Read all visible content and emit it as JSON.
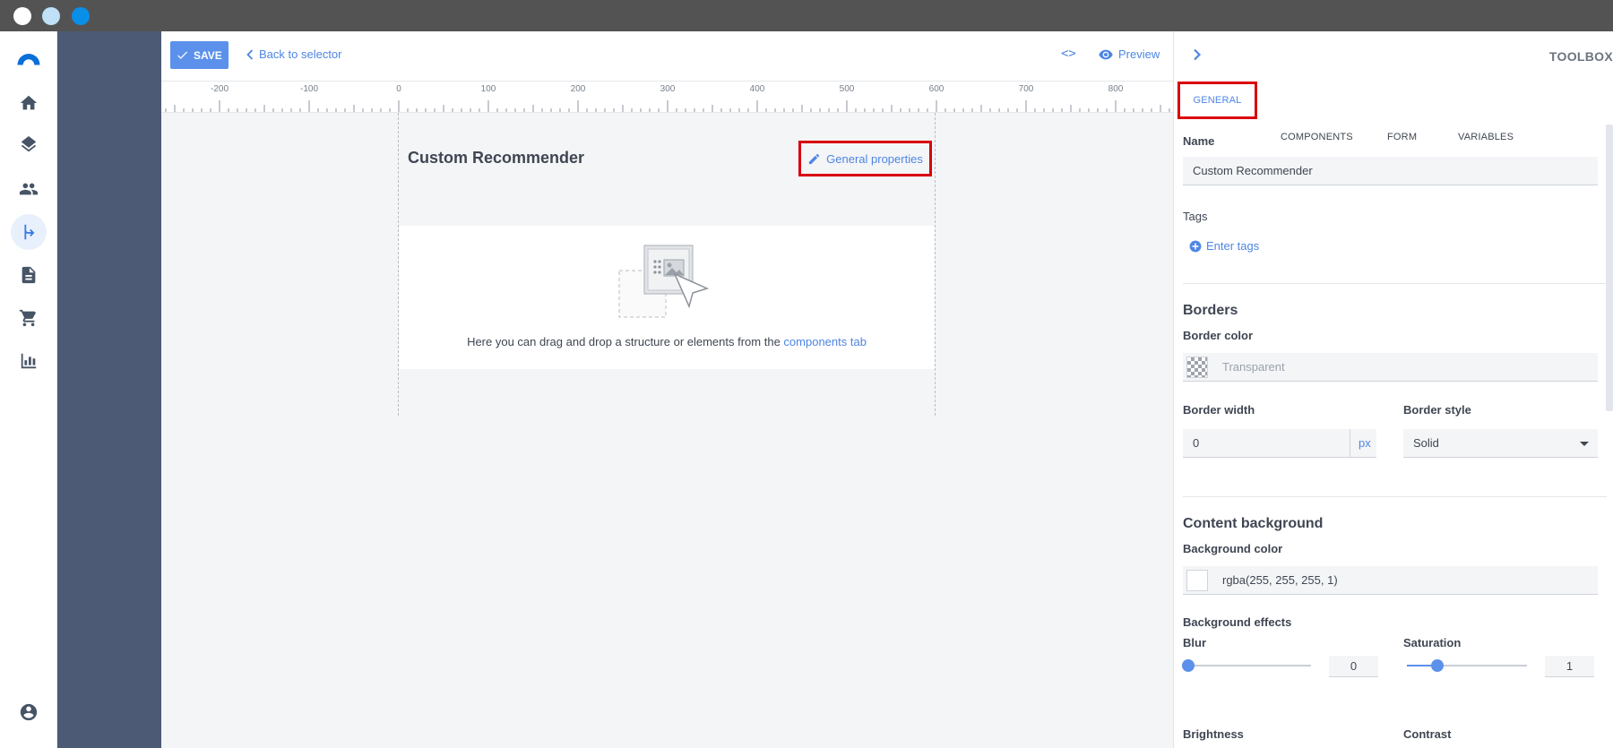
{
  "window": {
    "dots": [
      "#ffffff",
      "#bfe0f7",
      "#0a8fe8"
    ]
  },
  "rail": {
    "items": [
      "logo-icon",
      "home-icon",
      "layers-icon",
      "people-icon",
      "flow-icon",
      "document-icon",
      "cart-icon",
      "chart-icon",
      "account-icon"
    ],
    "active": "flow-icon"
  },
  "toolbar": {
    "save_label": "SAVE",
    "back_label": "Back to selector",
    "code_label": "<>",
    "preview_label": "Preview"
  },
  "ruler": {
    "labels": [
      "-200",
      "-100",
      "0",
      "100",
      "200",
      "300",
      "400",
      "500",
      "600",
      "700",
      "800"
    ]
  },
  "canvas": {
    "title": "Custom Recommender",
    "general_properties_label": "General properties",
    "dropzone_text": "Here you can drag and drop a structure or elements from the ",
    "dropzone_link": "components tab"
  },
  "toolbox": {
    "title": "TOOLBOX",
    "tabs": [
      "GENERAL",
      "COMPONENTS",
      "FORM",
      "VARIABLES"
    ],
    "active_tab": "GENERAL",
    "name_label": "Name",
    "name_value": "Custom Recommender",
    "tags_label": "Tags",
    "tags_placeholder": "Enter tags",
    "borders_heading": "Borders",
    "border_color_label": "Border color",
    "border_color_value": "Transparent",
    "border_width_label": "Border width",
    "border_width_value": "0",
    "border_width_unit": "px",
    "border_style_label": "Border style",
    "border_style_value": "Solid",
    "content_bg_heading": "Content background",
    "bg_color_label": "Background color",
    "bg_color_value": "rgba(255, 255, 255, 1)",
    "bg_effects_label": "Background effects",
    "blur_label": "Blur",
    "blur_value": "0",
    "saturation_label": "Saturation",
    "saturation_value": "1",
    "brightness_label": "Brightness",
    "contrast_label": "Contrast"
  },
  "colors": {
    "accent": "#5b91eb",
    "highlight": "#d9000d",
    "sidebar_dark": "#4d5a75"
  }
}
